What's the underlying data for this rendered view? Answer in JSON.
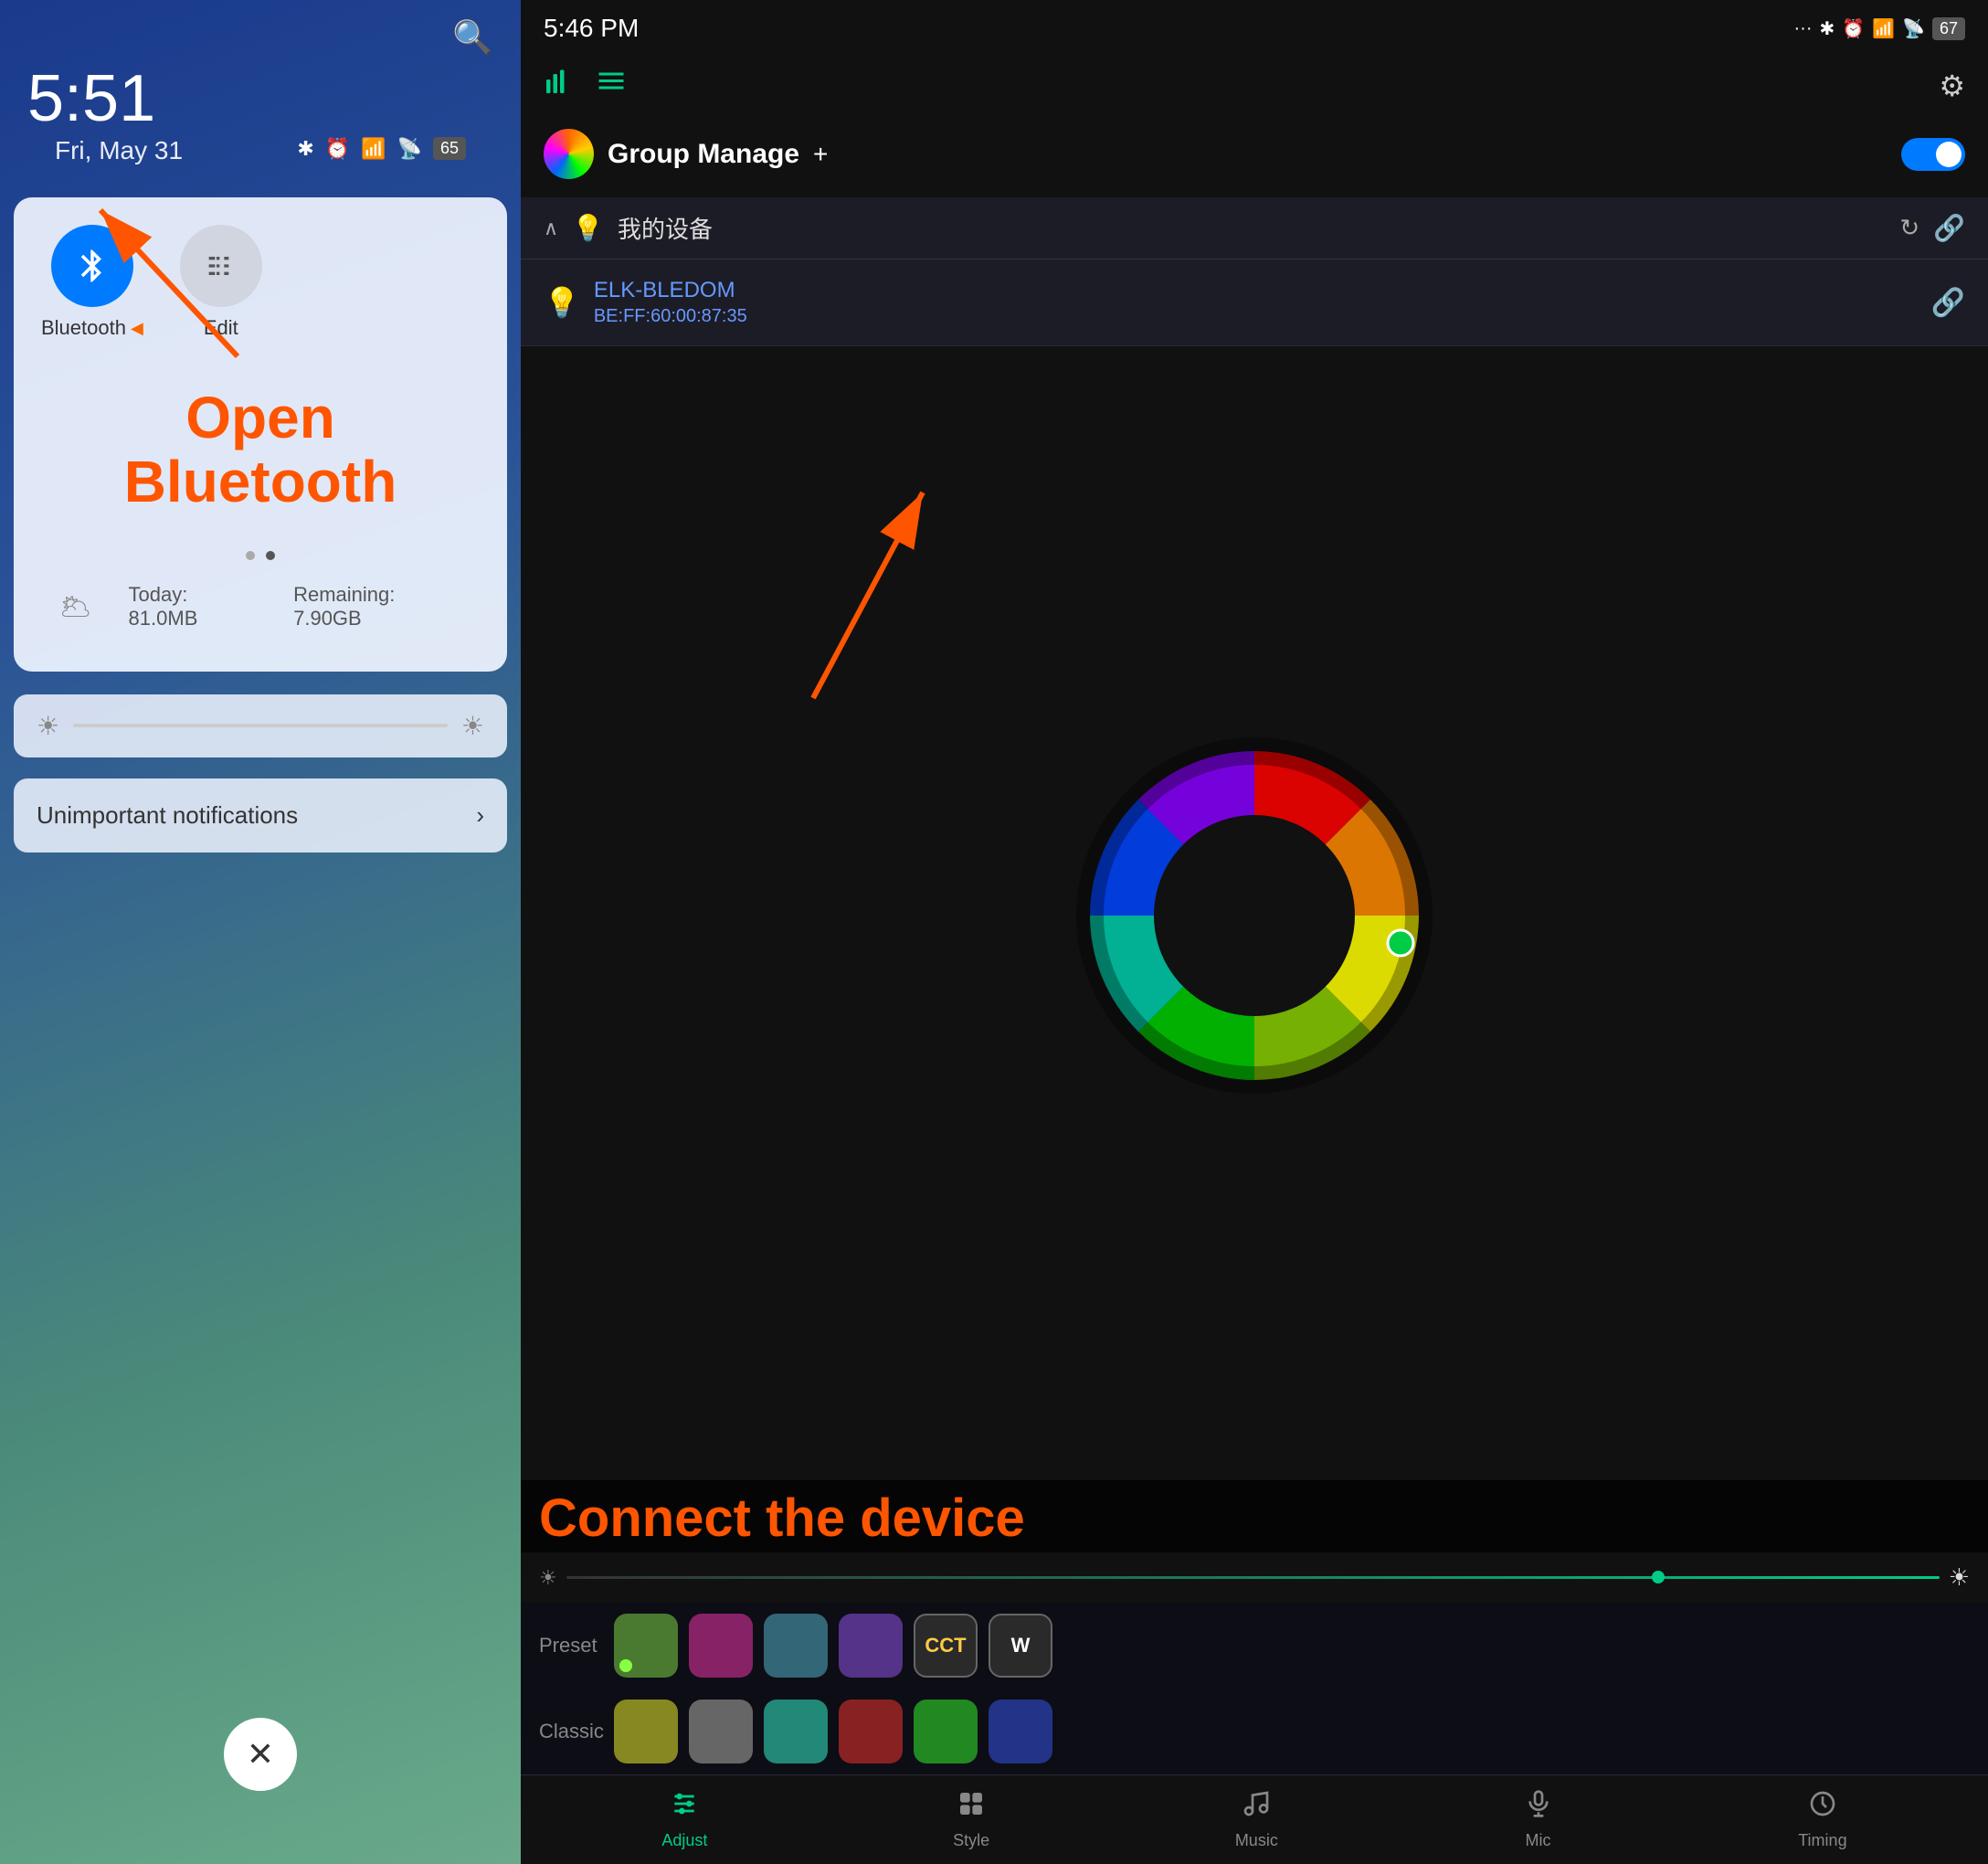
{
  "left": {
    "time": "5:51",
    "date": "Fri, May 31",
    "search_icon": "🔍",
    "bluetooth_label": "Bluetooth",
    "edit_label": "Edit",
    "open_bluetooth_text": "Open Bluetooth",
    "dot1_active": false,
    "dot2_active": true,
    "data_today": "Today: 81.0MB",
    "data_remaining": "Remaining: 7.90GB",
    "brightness_icon_left": "☀",
    "brightness_icon_right": "☀",
    "notif_text": "Unimportant notifications",
    "close_icon": "✕"
  },
  "right": {
    "status_time": "5:46 PM",
    "battery": "67",
    "group_manage_title": "Group Manage",
    "plus": "+",
    "device_section_title": "我的设备",
    "device_name": "ELK-BLEDOM",
    "device_mac": "BE:FF:60:00:87:35",
    "connect_device_text": "Connect the device",
    "preset_label": "Preset",
    "classic_label": "Classic",
    "nav_adjust": "Adjust",
    "nav_style": "Style",
    "nav_music": "Music",
    "nav_mic": "Mic",
    "nav_timing": "Timing",
    "preset_colors": [
      {
        "color": "#4a7a30",
        "label": ""
      },
      {
        "color": "#882266",
        "label": ""
      },
      {
        "color": "#336677",
        "label": ""
      },
      {
        "color": "#553388",
        "label": ""
      },
      {
        "color": "#ccaa22",
        "text": "CCT"
      },
      {
        "color": "#333333",
        "text": "W"
      }
    ],
    "classic_colors": [
      {
        "color": "#888822"
      },
      {
        "color": "#666666"
      },
      {
        "color": "#228877"
      },
      {
        "color": "#882222"
      },
      {
        "color": "#228822"
      },
      {
        "color": "#223388"
      }
    ]
  }
}
